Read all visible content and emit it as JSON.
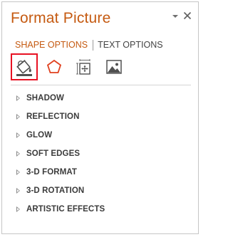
{
  "pane": {
    "title": "Format Picture"
  },
  "tabs": [
    {
      "label": "SHAPE OPTIONS",
      "active": true
    },
    {
      "label": "TEXT OPTIONS",
      "active": false
    }
  ],
  "icon_tabs": [
    {
      "icon": "fill-line-icon",
      "label": "Fill & Line",
      "selected": true
    },
    {
      "icon": "effects-pentagon-icon",
      "label": "Effects",
      "selected": false
    },
    {
      "icon": "size-properties-icon",
      "label": "Size & Properties",
      "selected": false
    },
    {
      "icon": "picture-icon",
      "label": "Picture",
      "selected": false
    }
  ],
  "sections": [
    {
      "label": "SHADOW",
      "expanded": false
    },
    {
      "label": "REFLECTION",
      "expanded": false
    },
    {
      "label": "GLOW",
      "expanded": false
    },
    {
      "label": "SOFT EDGES",
      "expanded": false
    },
    {
      "label": "3-D FORMAT",
      "expanded": false
    },
    {
      "label": "3-D ROTATION",
      "expanded": false
    },
    {
      "label": "ARTISTIC EFFECTS",
      "expanded": false
    }
  ],
  "colors": {
    "accent": "#c55a11",
    "selection_border": "#e81123",
    "text": "#444444",
    "divider": "#d4d4d4"
  }
}
